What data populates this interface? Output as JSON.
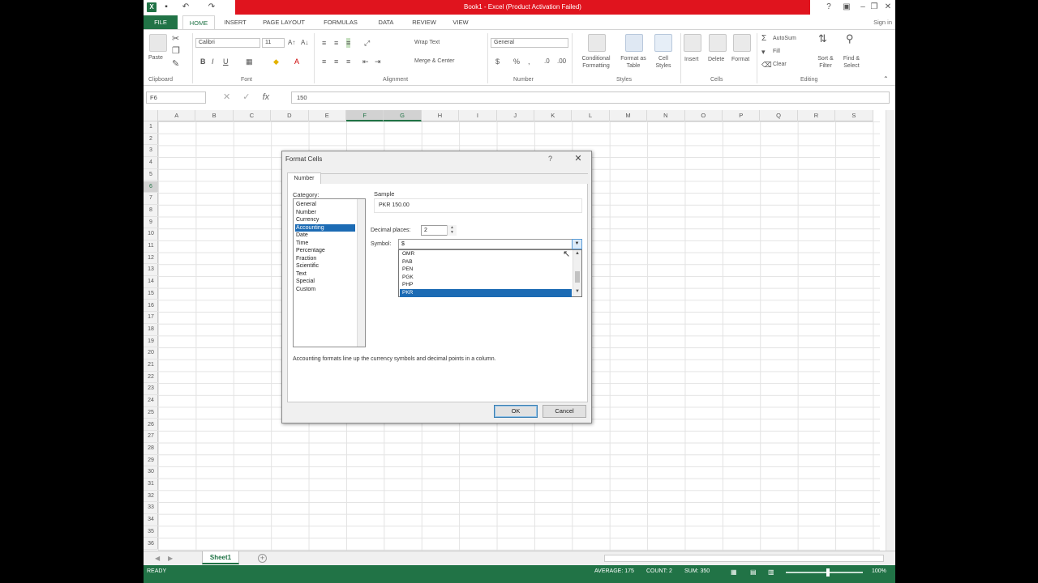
{
  "window": {
    "title": "Book1 - Excel (Product Activation Failed)",
    "signin": "Sign in"
  },
  "tabs": [
    "FILE",
    "HOME",
    "INSERT",
    "PAGE LAYOUT",
    "FORMULAS",
    "DATA",
    "REVIEW",
    "VIEW"
  ],
  "ribbon": {
    "paste": "Paste",
    "font_name": "Calibri",
    "font_size": "11",
    "wrap_text": "Wrap Text",
    "merge_center": "Merge & Center",
    "number_format": "General",
    "conditional_formatting": "Conditional Formatting",
    "format_as_table": "Format as Table",
    "cell_styles": "Cell Styles",
    "insert": "Insert",
    "delete": "Delete",
    "format": "Format",
    "autosum": "AutoSum",
    "fill": "Fill",
    "clear": "Clear",
    "sort_filter": "Sort & Filter",
    "find_select": "Find & Select",
    "groups": [
      "Clipboard",
      "Font",
      "Alignment",
      "Number",
      "Styles",
      "Cells",
      "Editing"
    ]
  },
  "formula_bar": {
    "name_box": "F6",
    "fx": "fx",
    "value": "150"
  },
  "columns": [
    "A",
    "B",
    "C",
    "D",
    "E",
    "F",
    "G",
    "H",
    "I",
    "J",
    "K",
    "L",
    "M",
    "N",
    "O",
    "P",
    "Q",
    "R",
    "S"
  ],
  "rows": [
    "1",
    "2",
    "3",
    "4",
    "5",
    "6",
    "7",
    "8",
    "9",
    "10",
    "11",
    "12",
    "13",
    "14",
    "15",
    "16",
    "17",
    "18",
    "19",
    "20",
    "21",
    "22",
    "23",
    "24",
    "25",
    "26",
    "27",
    "28",
    "29",
    "30",
    "31",
    "32",
    "33",
    "34",
    "35",
    "36"
  ],
  "sheet_tab": "Sheet1",
  "status": {
    "ready": "READY",
    "average": "AVERAGE: 175",
    "count": "COUNT: 2",
    "sum": "SUM: 350",
    "zoom": "100%"
  },
  "dialog": {
    "title": "Format Cells",
    "help": "?",
    "close": "✕",
    "tab": "Number",
    "category_label": "Category:",
    "categories": [
      "General",
      "Number",
      "Currency",
      "Accounting",
      "Date",
      "Time",
      "Percentage",
      "Fraction",
      "Scientific",
      "Text",
      "Special",
      "Custom"
    ],
    "selected_category": "Accounting",
    "sample_label": "Sample",
    "sample_value": "PKR 150.00",
    "decimal_label": "Decimal places:",
    "decimal_value": "2",
    "symbol_label": "Symbol:",
    "symbol_value": "$",
    "symbol_options": [
      "OMR",
      "PAB",
      "PEN",
      "PGK",
      "PHP",
      "PKR"
    ],
    "selected_symbol": "PKR",
    "description": "Accounting formats line up the currency symbols and decimal points in a column.",
    "ok": "OK",
    "cancel": "Cancel"
  },
  "colors": {
    "excel_green": "#217346",
    "title_red": "#e0141e",
    "selection_blue": "#1c6bb4"
  }
}
